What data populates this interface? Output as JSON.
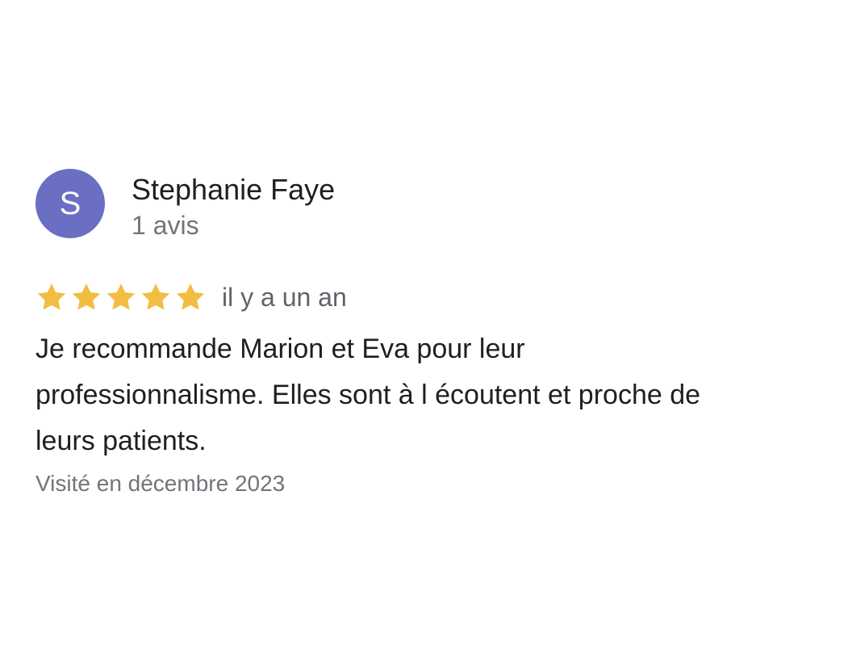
{
  "review": {
    "avatar_letter": "S",
    "avatar_color": "#6b6fc3",
    "author_name": "Stephanie Faye",
    "author_reviews": "1 avis",
    "rating": 5,
    "rating_max": 5,
    "star_color": "#f2bd42",
    "time_ago": "il y a un an",
    "text_lines": [
      "Je recommande Marion et Eva pour leur",
      "professionnalisme. Elles sont à l écoutent et proche de",
      "leurs patients."
    ],
    "visit": "Visité en décembre 2023"
  }
}
